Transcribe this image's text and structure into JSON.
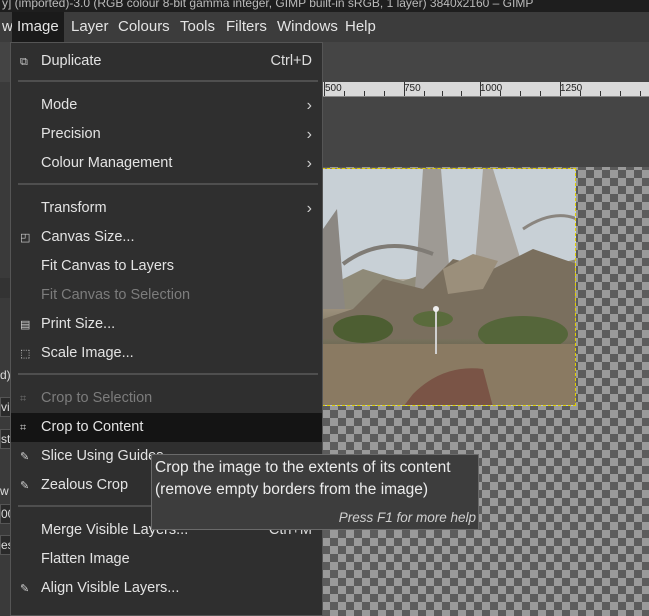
{
  "window": {
    "title_fragment": "y] (imported)-3.0 (RGB colour 8-bit gamma integer, GIMP built-in sRGB, 1 layer) 3840x2160 – GIMP"
  },
  "menubar": {
    "items": [
      {
        "label": "w"
      },
      {
        "label": "Image"
      },
      {
        "label": "Layer"
      },
      {
        "label": "Colours"
      },
      {
        "label": "Tools"
      },
      {
        "label": "Filters"
      },
      {
        "label": "Windows"
      },
      {
        "label": "Help"
      }
    ]
  },
  "ruler": {
    "labels": [
      "500",
      "750",
      "1000",
      "1250"
    ]
  },
  "left_panel": {
    "fragments": [
      "d)",
      "vic",
      "st",
      "w",
      "00",
      "es"
    ]
  },
  "image_menu": {
    "items": [
      {
        "label": "Duplicate",
        "accel": "Ctrl+D",
        "icon": "duplicate-icon"
      },
      {
        "label": "Mode",
        "submenu": true
      },
      {
        "label": "Precision",
        "submenu": true
      },
      {
        "label": "Colour Management",
        "submenu": true
      },
      {
        "label": "Transform",
        "submenu": true
      },
      {
        "label": "Canvas Size...",
        "icon": "canvas-size-icon"
      },
      {
        "label": "Fit Canvas to Layers"
      },
      {
        "label": "Fit Canvas to Selection",
        "disabled": true
      },
      {
        "label": "Print Size...",
        "icon": "print-icon"
      },
      {
        "label": "Scale Image...",
        "icon": "scale-icon"
      },
      {
        "label": "Crop to Selection",
        "disabled": true,
        "icon": "crop-icon"
      },
      {
        "label": "Crop to Content",
        "icon": "crop-icon",
        "highlighted": true
      },
      {
        "label": "Slice Using Guides",
        "icon": "slice-icon"
      },
      {
        "label": "Zealous Crop",
        "icon": "zealous-crop-icon"
      },
      {
        "label": "Merge Visible Layers...",
        "accel": "Ctrl+M"
      },
      {
        "label": "Flatten Image"
      },
      {
        "label": "Align Visible Layers...",
        "icon": "align-icon"
      }
    ]
  },
  "tooltip": {
    "line1": "Crop the image to the extents of its content",
    "line2": "(remove empty borders from the image)",
    "help": "Press F1 for more help"
  },
  "colors": {
    "menu_bg": "#2f2f2f",
    "highlight_bg": "#141414",
    "disabled_text": "#7c7c7c",
    "selection_marching_ants": "#e0d000"
  }
}
